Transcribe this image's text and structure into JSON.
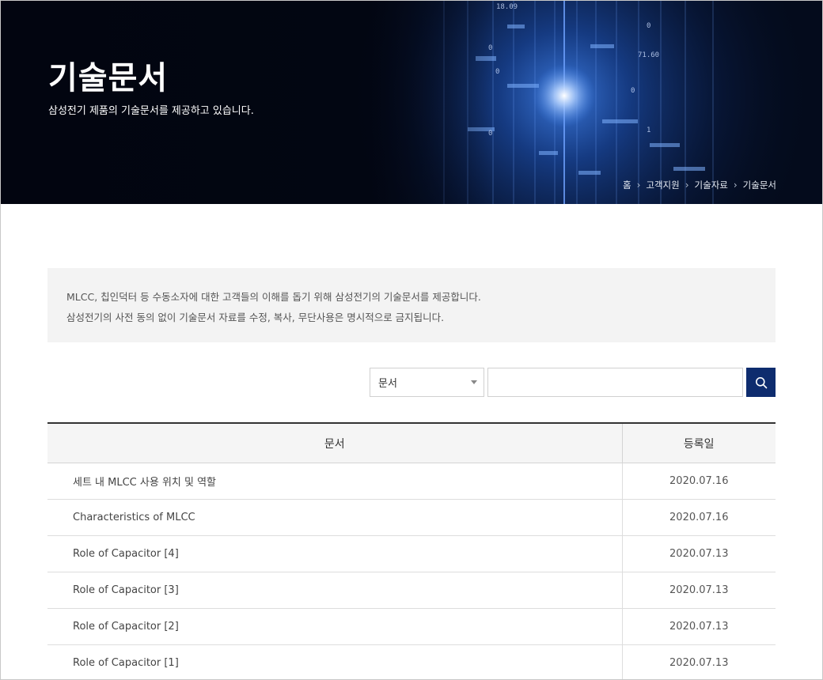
{
  "hero": {
    "title": "기술문서",
    "subtitle": "삼성전기 제품의 기술문서를 제공하고 있습니다.",
    "breadcrumb": [
      "홈",
      "고객지원",
      "기술자료",
      "기술문서"
    ],
    "bg_numbers": [
      "18.09",
      "71.60",
      "0",
      "1"
    ]
  },
  "notice": {
    "line1": "MLCC, 칩인덕터 등 수동소자에 대한 고객들의 이해를 돕기 위해 삼성전기의 기술문서를 제공합니다.",
    "line2": "삼성전기의 사전 동의 없이 기술문서 자료를 수정, 복사, 무단사용은 명시적으로 금지됩니다."
  },
  "search": {
    "select_value": "문서",
    "input_value": "",
    "input_placeholder": "",
    "button_icon": "search-icon",
    "button_color": "#0e2c6e"
  },
  "table": {
    "headers": [
      "문서",
      "등록일"
    ],
    "rows": [
      {
        "title": "세트 내 MLCC 사용 위치 및 역할",
        "date": "2020.07.16"
      },
      {
        "title": "Characteristics of MLCC",
        "date": "2020.07.16"
      },
      {
        "title": "Role of Capacitor [4]",
        "date": "2020.07.13"
      },
      {
        "title": "Role of Capacitor [3]",
        "date": "2020.07.13"
      },
      {
        "title": "Role of Capacitor [2]",
        "date": "2020.07.13"
      },
      {
        "title": "Role of Capacitor [1]",
        "date": "2020.07.13"
      }
    ]
  }
}
